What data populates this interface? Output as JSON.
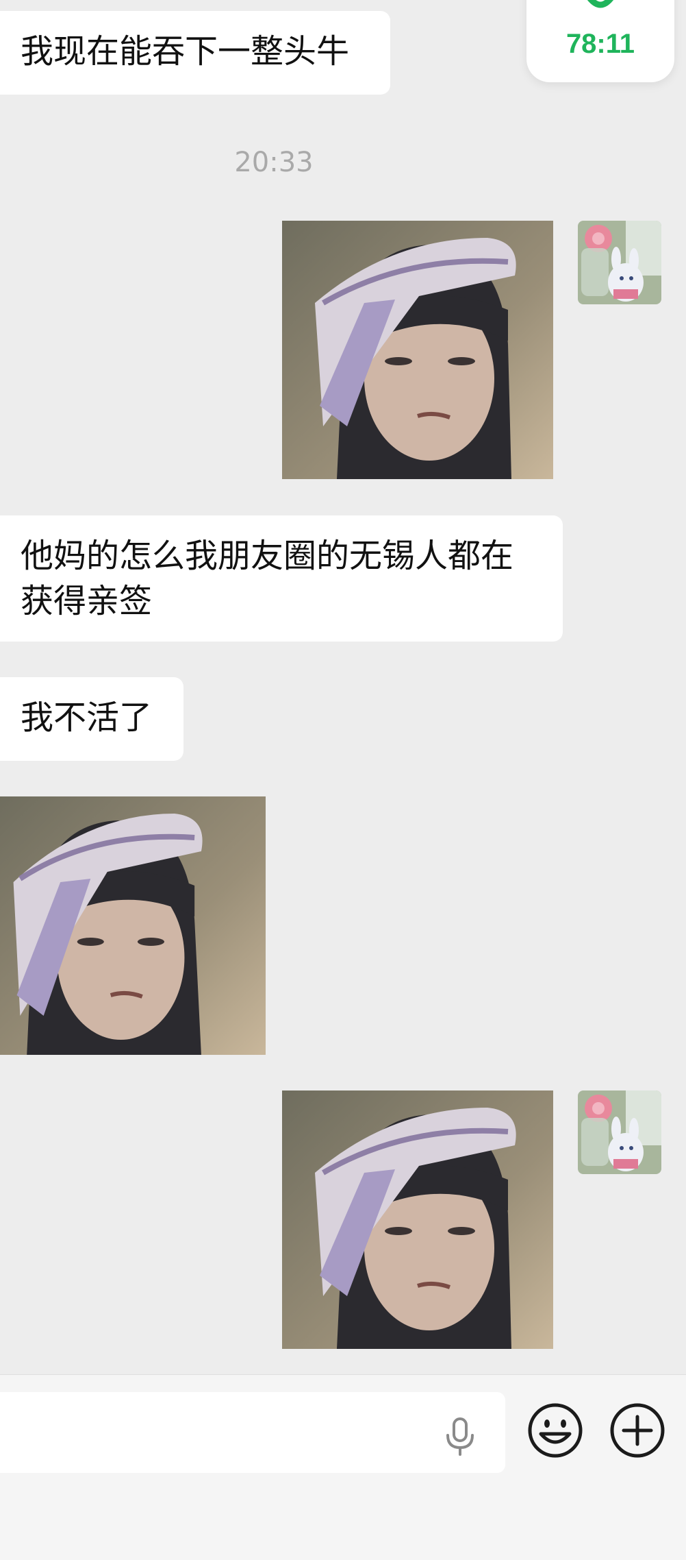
{
  "call": {
    "timer": "78:11",
    "icon": "phone-icon",
    "color": "#1fb45b"
  },
  "messages": [
    {
      "side": "left",
      "type": "text",
      "text": "我现在能吞下一整头牛"
    },
    {
      "type": "timestamp",
      "text": "20:33"
    },
    {
      "side": "right",
      "type": "sticker",
      "icon": "girl-headband-sticker"
    },
    {
      "side": "left",
      "type": "text",
      "text": "他妈的怎么我朋友圈的无锡人都在获得亲签"
    },
    {
      "side": "left",
      "type": "text",
      "text": "我不活了"
    },
    {
      "side": "left",
      "type": "sticker",
      "icon": "girl-headband-sticker"
    },
    {
      "side": "right",
      "type": "sticker",
      "icon": "girl-headband-sticker"
    }
  ],
  "input_bar": {
    "icons": [
      "microphone-icon",
      "emoji-icon",
      "plus-icon"
    ]
  },
  "colors": {
    "background": "#ededed",
    "bubble": "#ffffff",
    "accent": "#1fb45b"
  }
}
